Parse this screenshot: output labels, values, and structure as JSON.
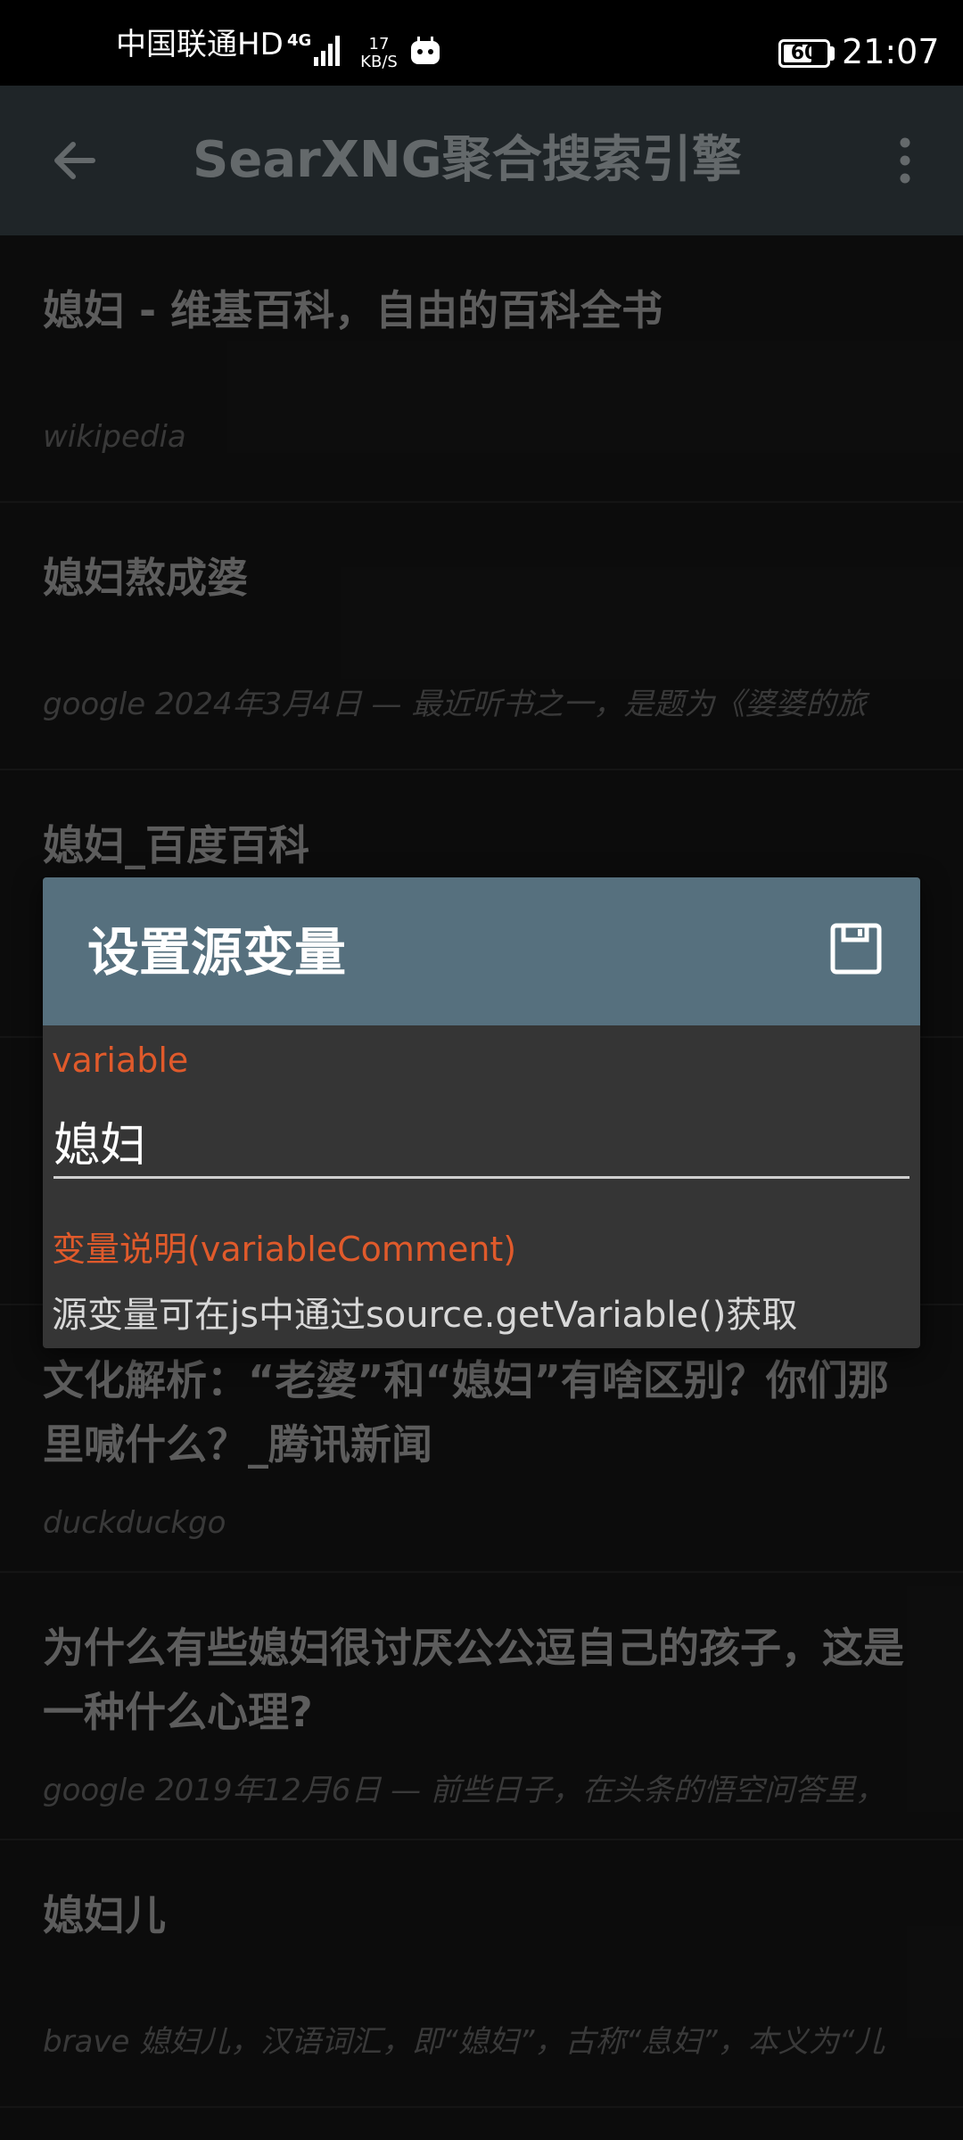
{
  "status_bar": {
    "carrier": "中国联通HD",
    "network": "4G",
    "speed_value": "17",
    "speed_unit": "KB/S",
    "battery": "60",
    "time": "21:07"
  },
  "app_bar": {
    "title": "SearXNG聚合搜索引擎"
  },
  "results": [
    {
      "title": "媳妇 - 维基百科，自由的百科全书",
      "snippet": "wikipedia"
    },
    {
      "title": "媳妇熬成婆",
      "snippet": "google 2024年3月4日 — 最近听书之一，是题为《婆婆的旅"
    },
    {
      "title": "媳妇_百度百科",
      "snippet": ""
    },
    {
      "title": "",
      "snippet": ""
    },
    {
      "title": "文化解析：“老婆”和“媳妇”有啥区别？你们那里喊什么？_腾讯新闻",
      "snippet": "duckduckgo"
    },
    {
      "title": "为什么有些媳妇很讨厌公公逗自己的孩子，这是一种什么心理?",
      "snippet": "google 2019年12月6日 — 前些日子，在头条的悟空问答里，"
    },
    {
      "title": "媳妇儿",
      "snippet": "brave 媳妇儿，汉语词汇，即“媳妇”，古称“息妇”，本义为“儿"
    }
  ],
  "dialog": {
    "title": "设置源变量",
    "variable_label": "variable",
    "variable_value": "媳妇",
    "comment_label": "变量说明(variableComment)",
    "comment_text": "源变量可在js中通过source.getVariable()获取"
  },
  "colors": {
    "app_bar": "#2a3236",
    "dialog_header": "#56707e",
    "dialog_body": "#353535",
    "accent_label": "#e05a2b"
  }
}
